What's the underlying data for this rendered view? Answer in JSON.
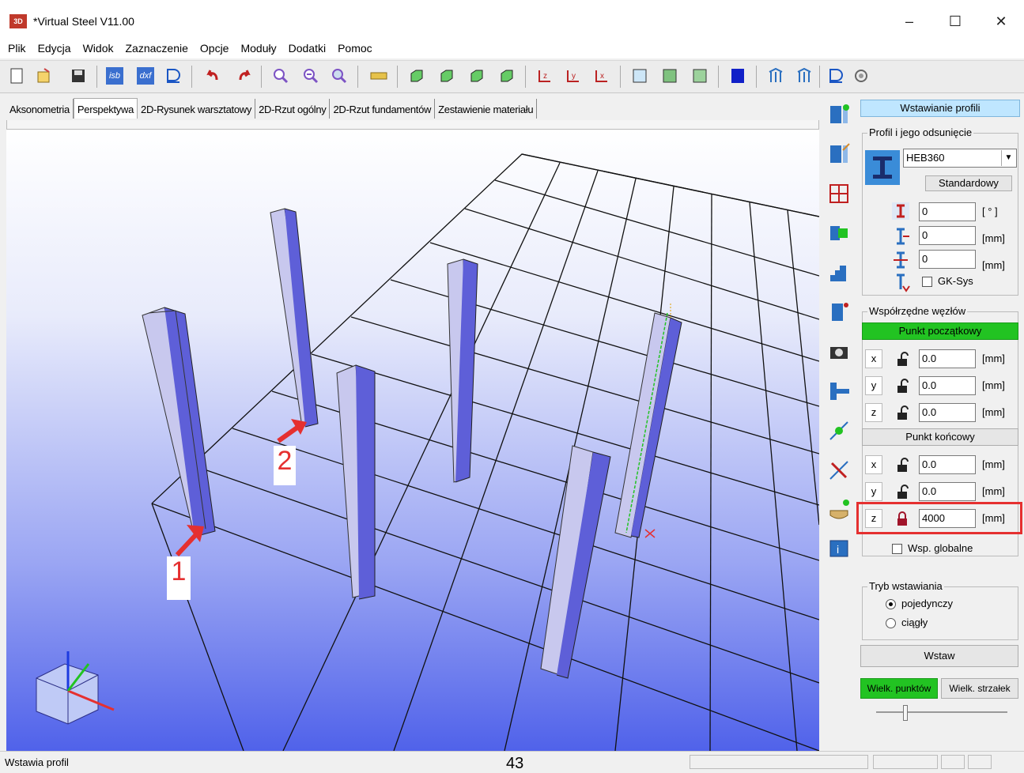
{
  "window": {
    "title": "*Virtual Steel V11.00",
    "app_icon_text": "3D",
    "min": "–",
    "max": "☐",
    "close": "✕"
  },
  "menu": [
    "Plik",
    "Edycja",
    "Widok",
    "Zaznaczenie",
    "Opcje",
    "Moduły",
    "Dodatki",
    "Pomoc"
  ],
  "tabs": [
    "Aksonometria",
    "Perspektywa",
    "2D-Rysunek warsztatowy",
    "2D-Rzut ogólny",
    "2D-Rzut fundamentów",
    "Zestawienie materiału"
  ],
  "active_tab": "Perspektywa",
  "toolbar_icons": [
    "new-icon",
    "open-icon",
    "save-icon",
    "isb-icon",
    "dxf-icon",
    "print-preview-icon",
    "undo-icon",
    "redo-icon",
    "zoom-icon",
    "zoom-out-icon",
    "zoom-window-icon",
    "measure-icon",
    "view-iso1-icon",
    "view-iso2-icon",
    "view-iso3-icon",
    "view-iso4-icon",
    "view-z-icon",
    "view-y-icon",
    "view-x-icon",
    "table1-icon",
    "table2-icon",
    "table3-icon",
    "color-icon",
    "frame1-icon",
    "frame2-icon",
    "print-icon",
    "settings-icon"
  ],
  "toolbar_text": {
    "isb": "isb",
    "dxf": "dxf"
  },
  "panel": {
    "header": "Wstawianie profili",
    "profile_group": "Profil i jego odsunięcie",
    "profile_value": "HEB360",
    "standard_btn": "Standardowy",
    "rot_value": "0",
    "rot_unit": "[ ° ]",
    "off1_value": "0",
    "off1_unit": "[mm]",
    "off2_value": "0",
    "off2_unit": "[mm]",
    "gksys_label": "GK-Sys",
    "coords_group": "Współrzędne węzłów",
    "start_btn": "Punkt początkowy",
    "end_btn": "Punkt końcowy",
    "start": {
      "x": "0.0",
      "y": "0.0",
      "z": "0.0"
    },
    "end": {
      "x": "0.0",
      "y": "0.0",
      "z": "4000"
    },
    "axis_x": "x",
    "axis_y": "y",
    "axis_z": "z",
    "unit_mm": "[mm]",
    "global_label": "Wsp. globalne",
    "mode_group": "Tryb wstawiania",
    "mode_single": "pojedynczy",
    "mode_cont": "ciągły",
    "insert_btn": "Wstaw",
    "pt_size_btn": "Wielk. punktów",
    "arrow_size_btn": "Wielk. strzałek"
  },
  "annotations": {
    "label1": "1",
    "label2": "2"
  },
  "status": {
    "text": "Wstawia profil",
    "page": "43"
  },
  "colors": {
    "accent_green": "#22c322",
    "annot_red": "#e53030",
    "header_blue": "#bfe6ff",
    "column": "#6d6ee0"
  }
}
